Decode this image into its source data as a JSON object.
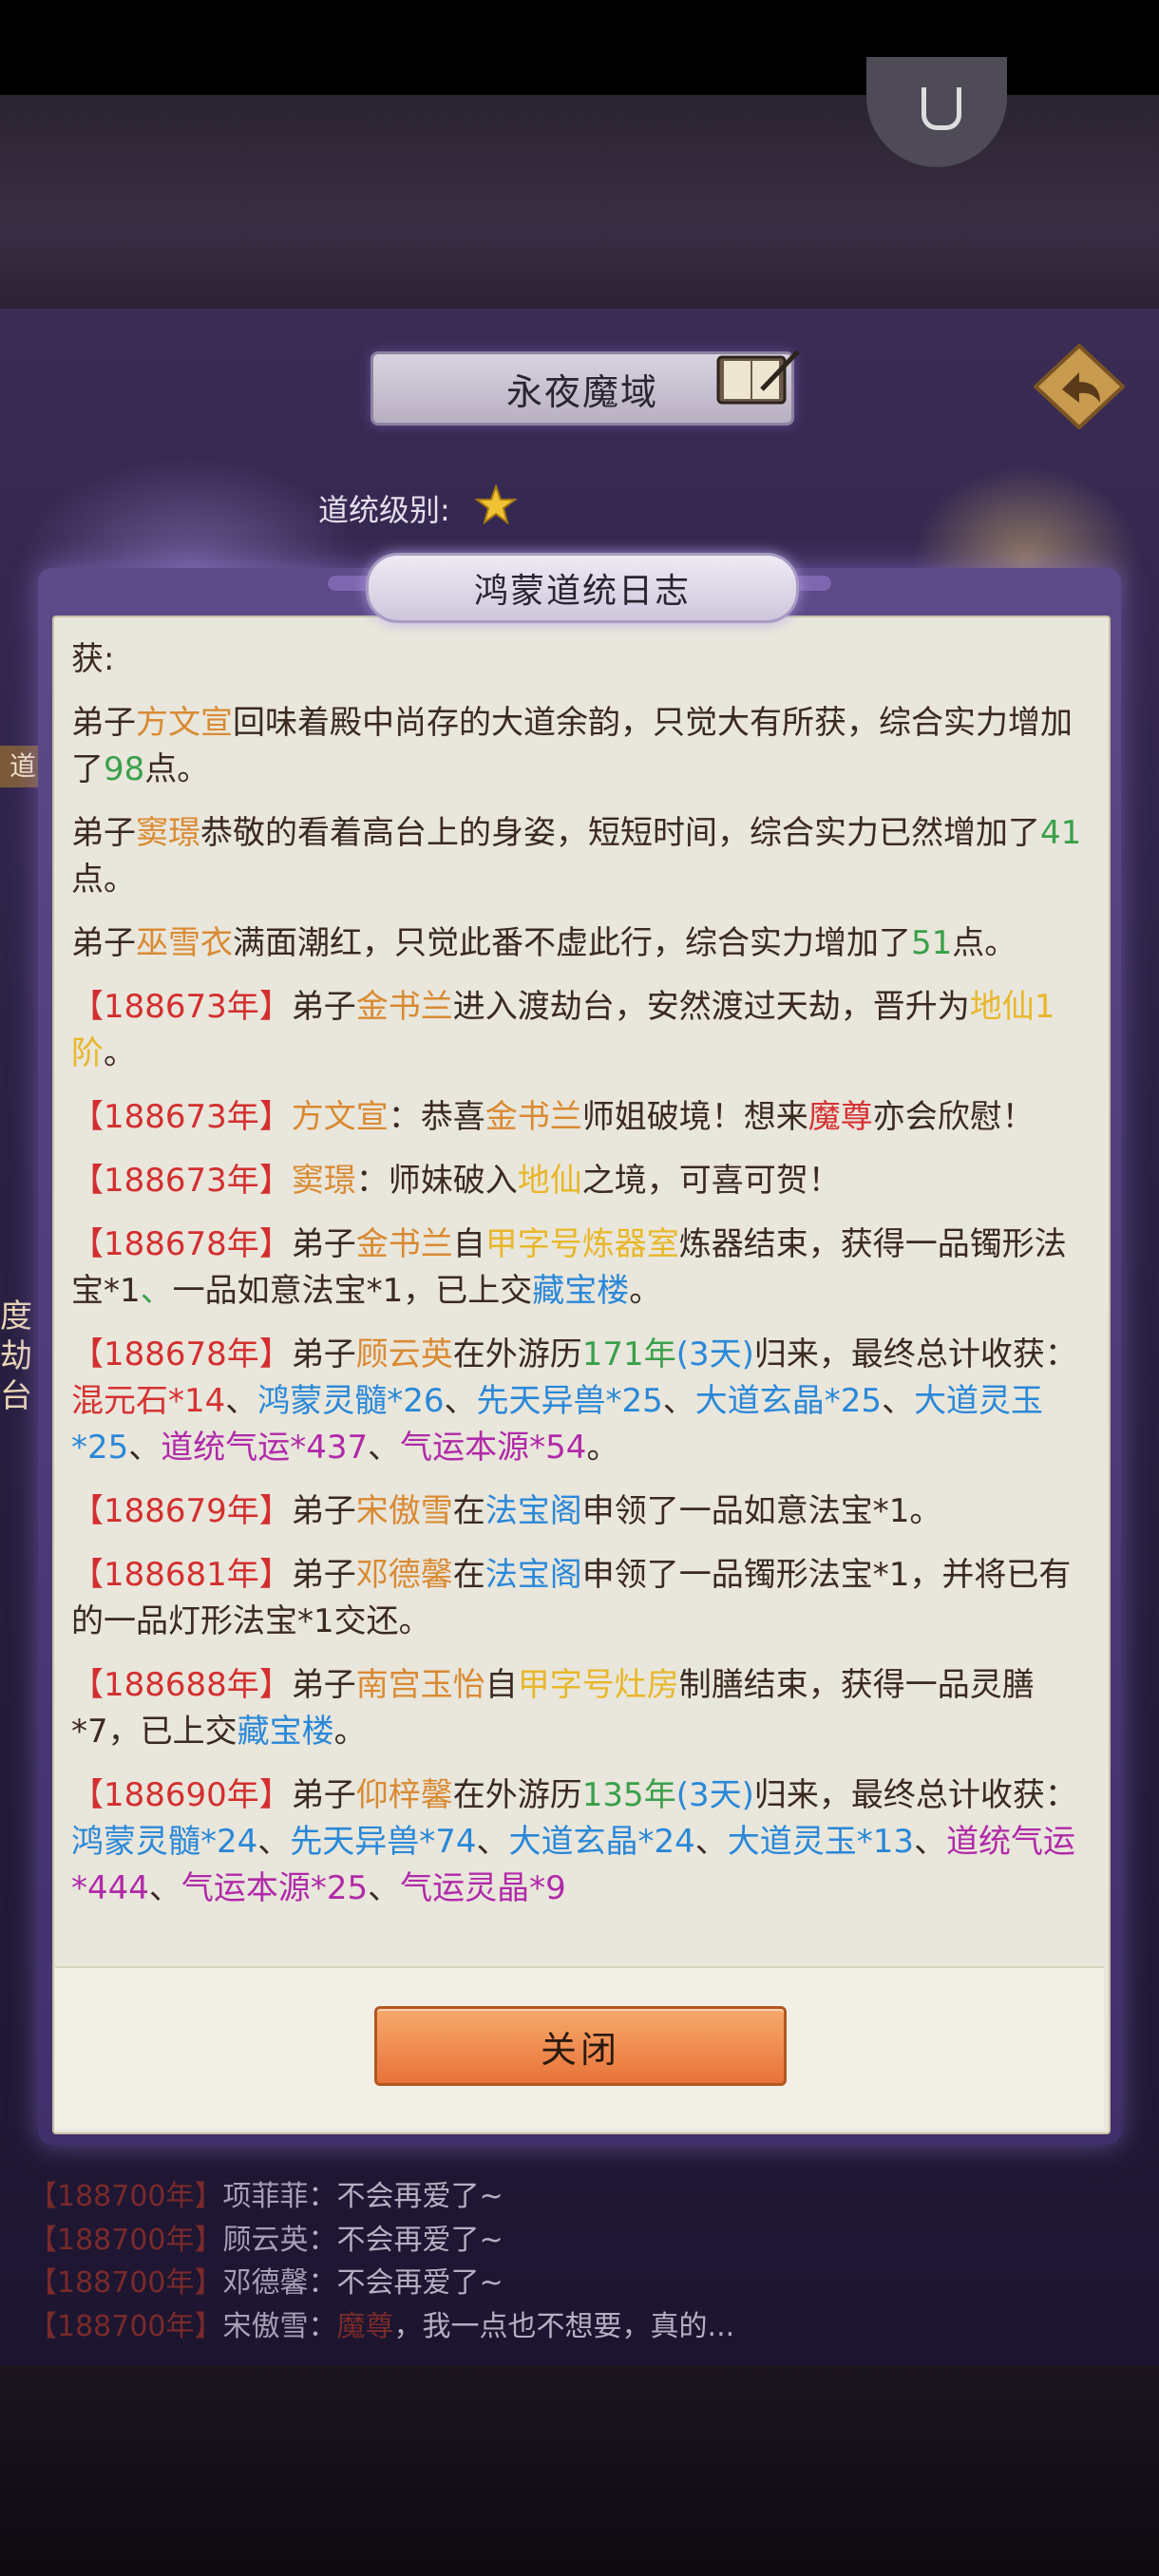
{
  "header": {
    "title": "永夜魔域",
    "rank_label": "道统级别:"
  },
  "side_labels": {
    "left_tag": "道",
    "left_vertical": "度劫台"
  },
  "modal": {
    "title": "鸿蒙道统日志",
    "close_label": "关闭",
    "entries": [
      {
        "parts": [
          {
            "t": "获:",
            "c": ""
          }
        ]
      },
      {
        "parts": [
          {
            "t": "弟子",
            "c": ""
          },
          {
            "t": "方文宣",
            "c": "nm"
          },
          {
            "t": "回味着殿中尚存的大道余韵，只觉大有所获，综合实力增加了",
            "c": ""
          },
          {
            "t": "98",
            "c": "gn"
          },
          {
            "t": "点。",
            "c": ""
          }
        ]
      },
      {
        "parts": [
          {
            "t": "弟子",
            "c": ""
          },
          {
            "t": "窦璟",
            "c": "nm"
          },
          {
            "t": "恭敬的看着高台上的身姿，短短时间，综合实力已然增加了",
            "c": ""
          },
          {
            "t": "41",
            "c": "gn"
          },
          {
            "t": "点。",
            "c": ""
          }
        ]
      },
      {
        "parts": [
          {
            "t": "弟子",
            "c": ""
          },
          {
            "t": "巫雪衣",
            "c": "nm"
          },
          {
            "t": "满面潮红，只觉此番不虚此行，综合实力增加了",
            "c": ""
          },
          {
            "t": "51",
            "c": "gn"
          },
          {
            "t": "点。",
            "c": ""
          }
        ]
      },
      {
        "parts": [
          {
            "t": "【188673年】",
            "c": "yr"
          },
          {
            "t": "弟子",
            "c": ""
          },
          {
            "t": "金书兰",
            "c": "nm"
          },
          {
            "t": "进入渡劫台，安然渡过天劫，晋升为",
            "c": ""
          },
          {
            "t": "地仙1阶",
            "c": "gd"
          },
          {
            "t": "。",
            "c": ""
          }
        ]
      },
      {
        "parts": [
          {
            "t": "【188673年】",
            "c": "yr"
          },
          {
            "t": "方文宣",
            "c": "nm"
          },
          {
            "t": "：恭喜",
            "c": ""
          },
          {
            "t": "金书兰",
            "c": "nm"
          },
          {
            "t": "师姐破境！想来",
            "c": ""
          },
          {
            "t": "魔尊",
            "c": "rd"
          },
          {
            "t": "亦会欣慰！",
            "c": ""
          }
        ]
      },
      {
        "parts": [
          {
            "t": "【188673年】",
            "c": "yr"
          },
          {
            "t": "窦璟",
            "c": "nm"
          },
          {
            "t": "：师妹破入",
            "c": ""
          },
          {
            "t": "地仙",
            "c": "gd"
          },
          {
            "t": "之境，可喜可贺！",
            "c": ""
          }
        ]
      },
      {
        "parts": [
          {
            "t": "【188678年】",
            "c": "yr"
          },
          {
            "t": "弟子",
            "c": ""
          },
          {
            "t": "金书兰",
            "c": "nm"
          },
          {
            "t": "自",
            "c": ""
          },
          {
            "t": "甲字号炼器室",
            "c": "gd"
          },
          {
            "t": "炼器结束，获得一品镯形法宝*1",
            "c": ""
          },
          {
            "t": "、",
            "c": "gn"
          },
          {
            "t": "一品如意法宝*1，已上交",
            "c": ""
          },
          {
            "t": "藏宝楼",
            "c": "bl"
          },
          {
            "t": "。",
            "c": ""
          }
        ]
      },
      {
        "parts": [
          {
            "t": "【188678年】",
            "c": "yr"
          },
          {
            "t": "弟子",
            "c": ""
          },
          {
            "t": "顾云英",
            "c": "nm"
          },
          {
            "t": "在外游历",
            "c": ""
          },
          {
            "t": "171年",
            "c": "gn"
          },
          {
            "t": "(3天)",
            "c": "bl"
          },
          {
            "t": "归来，最终总计收获：",
            "c": ""
          },
          {
            "t": "混元石*14",
            "c": "rd"
          },
          {
            "t": "、",
            "c": ""
          },
          {
            "t": "鸿蒙灵髓*26",
            "c": "bl"
          },
          {
            "t": "、",
            "c": ""
          },
          {
            "t": "先天异兽*25",
            "c": "bl"
          },
          {
            "t": "、",
            "c": ""
          },
          {
            "t": "大道玄晶*25",
            "c": "bl"
          },
          {
            "t": "、",
            "c": ""
          },
          {
            "t": "大道灵玉*25",
            "c": "bl"
          },
          {
            "t": "、",
            "c": ""
          },
          {
            "t": "道统气运*437",
            "c": "pp"
          },
          {
            "t": "、",
            "c": ""
          },
          {
            "t": "气运本源*54",
            "c": "pp"
          },
          {
            "t": "。",
            "c": ""
          }
        ]
      },
      {
        "parts": [
          {
            "t": "【188679年】",
            "c": "yr"
          },
          {
            "t": "弟子",
            "c": ""
          },
          {
            "t": "宋傲雪",
            "c": "nm"
          },
          {
            "t": "在",
            "c": ""
          },
          {
            "t": "法宝阁",
            "c": "bl"
          },
          {
            "t": "申领了一品如意法宝*1。",
            "c": ""
          }
        ]
      },
      {
        "parts": [
          {
            "t": "【188681年】",
            "c": "yr"
          },
          {
            "t": "弟子",
            "c": ""
          },
          {
            "t": "邓德馨",
            "c": "nm"
          },
          {
            "t": "在",
            "c": ""
          },
          {
            "t": "法宝阁",
            "c": "bl"
          },
          {
            "t": "申领了一品镯形法宝*1，并将已有的一品灯形法宝*1交还。",
            "c": ""
          }
        ]
      },
      {
        "parts": [
          {
            "t": "【188688年】",
            "c": "yr"
          },
          {
            "t": "弟子",
            "c": ""
          },
          {
            "t": "南宫玉怡",
            "c": "nm"
          },
          {
            "t": "自",
            "c": ""
          },
          {
            "t": "甲字号灶房",
            "c": "gd"
          },
          {
            "t": "制膳结束，获得一品灵膳*7，已上交",
            "c": ""
          },
          {
            "t": "藏宝楼",
            "c": "bl"
          },
          {
            "t": "。",
            "c": ""
          }
        ]
      },
      {
        "parts": [
          {
            "t": "【188690年】",
            "c": "yr"
          },
          {
            "t": "弟子",
            "c": ""
          },
          {
            "t": "仰梓馨",
            "c": "nm"
          },
          {
            "t": "在外游历",
            "c": ""
          },
          {
            "t": "135年",
            "c": "gn"
          },
          {
            "t": "(3天)",
            "c": "bl"
          },
          {
            "t": "归来，最终总计收获：",
            "c": ""
          },
          {
            "t": "鸿蒙灵髓*24",
            "c": "bl"
          },
          {
            "t": "、",
            "c": ""
          },
          {
            "t": "先天异兽*74",
            "c": "bl"
          },
          {
            "t": "、",
            "c": ""
          },
          {
            "t": "大道玄晶*24",
            "c": "bl"
          },
          {
            "t": "、",
            "c": ""
          },
          {
            "t": "大道灵玉*13",
            "c": "bl"
          },
          {
            "t": "、",
            "c": ""
          },
          {
            "t": "道统气运*444",
            "c": "pp"
          },
          {
            "t": "、",
            "c": ""
          },
          {
            "t": "气运本源*25",
            "c": "pp"
          },
          {
            "t": "、",
            "c": ""
          },
          {
            "t": "气运灵晶*9",
            "c": "pp"
          }
        ]
      }
    ]
  },
  "chat": [
    {
      "year": "【188700年】",
      "name": "项菲菲",
      "text": "：不会再爱了~"
    },
    {
      "year": "【188700年】",
      "name": "顾云英",
      "text": "：不会再爱了~"
    },
    {
      "year": "【188700年】",
      "name": "邓德馨",
      "text": "：不会再爱了~"
    },
    {
      "year": "【188700年】",
      "name": "宋傲雪",
      "text": "：",
      "tail_red": "魔尊",
      "tail": "，我一点也不想要，真的..."
    }
  ],
  "colors": {
    "year_red": "#d32f2f",
    "name_orange": "#d98a32",
    "number_green": "#3aa04a",
    "realm_gold": "#e8b72a",
    "item_blue": "#2a88d8",
    "fortune_purple": "#b02aa8"
  },
  "icons": {
    "top_button": "headset-icon",
    "book": "book-quill-icon",
    "back": "back-arrow-icon",
    "rank": "star-icon"
  }
}
